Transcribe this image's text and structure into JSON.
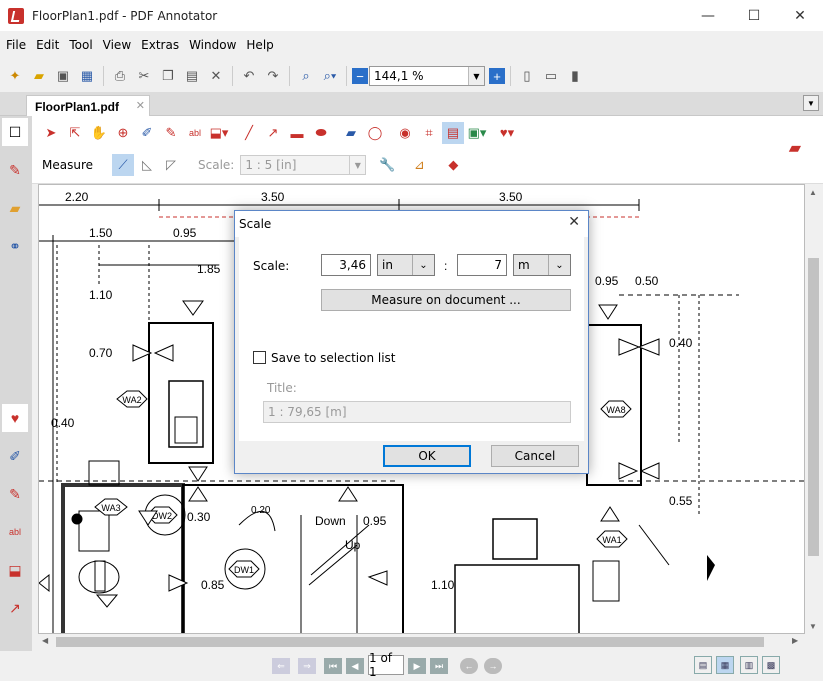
{
  "window": {
    "title": "FloorPlan1.pdf - PDF Annotator"
  },
  "menu": [
    "File",
    "Edit",
    "Tool",
    "View",
    "Extras",
    "Window",
    "Help"
  ],
  "toolbar": {
    "zoom_value": "144,1 %"
  },
  "tabs": {
    "doc_tab_label": "FloorPlan1.pdf"
  },
  "annotation_bar": {
    "measure_label": "Measure",
    "scale_label": "Scale:",
    "scale_value": "1 : 5 [in]"
  },
  "floorplan": {
    "dim_top": [
      "2.20",
      "3.50",
      "3.50"
    ],
    "dim_second": [
      "1.50",
      "0.95"
    ],
    "dim_labels": [
      "1.85",
      "1.10",
      "0.70",
      "0.40",
      "0.95",
      "0.50",
      "0.40",
      "0.55",
      "0.30",
      "0.20",
      "0.85",
      "0.95",
      "1.10"
    ],
    "room_tags": [
      "WA2",
      "WA3",
      "DW2",
      "DW1",
      "WA8",
      "WA1"
    ],
    "stair_labels": [
      "Down",
      "Up"
    ]
  },
  "dialog": {
    "title": "Scale",
    "scale_label": "Scale:",
    "value_left": "3,46",
    "unit_left": "in",
    "separator": ":",
    "value_right": "7",
    "unit_right": "m",
    "measure_button": "Measure on document ...",
    "save_checkbox_label": "Save to selection list",
    "title_label": "Title:",
    "title_value": "1 : 79,65 [m]",
    "ok_button": "OK",
    "cancel_button": "Cancel"
  },
  "statusbar": {
    "page_indicator": "1 of 1"
  },
  "colors": {
    "accent": "#c8312c",
    "dialog_border": "#5b86c7",
    "ok_border": "#0078d7"
  }
}
